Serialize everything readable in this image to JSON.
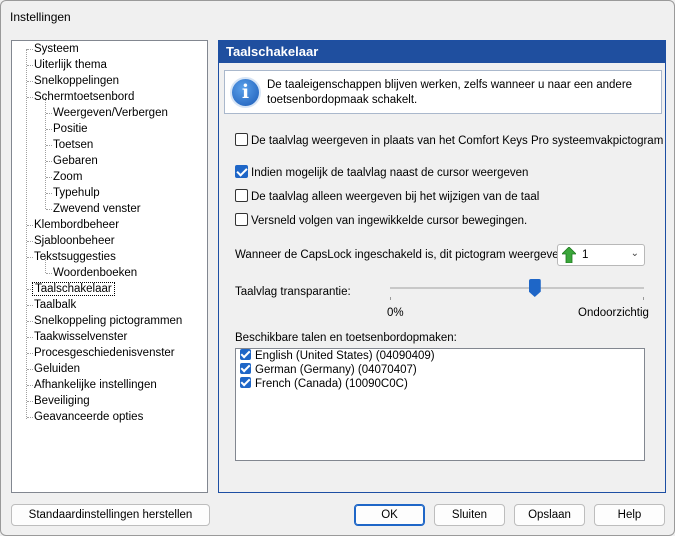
{
  "window": {
    "title": "Instellingen"
  },
  "tree": {
    "items": [
      {
        "label": "Systeem"
      },
      {
        "label": "Uiterlijk thema"
      },
      {
        "label": "Snelkoppelingen"
      },
      {
        "label": "Schermtoetsenbord"
      },
      {
        "label": "Weergeven/Verbergen"
      },
      {
        "label": "Positie"
      },
      {
        "label": "Toetsen"
      },
      {
        "label": "Gebaren"
      },
      {
        "label": "Zoom"
      },
      {
        "label": "Typehulp"
      },
      {
        "label": "Zwevend venster"
      },
      {
        "label": "Klembordbeheer"
      },
      {
        "label": "Sjabloonbeheer"
      },
      {
        "label": "Tekstsuggesties"
      },
      {
        "label": "Woordenboeken"
      },
      {
        "label": "Taalschakelaar"
      },
      {
        "label": "Taalbalk"
      },
      {
        "label": "Snelkoppeling pictogrammen"
      },
      {
        "label": "Taakwisselvenster"
      },
      {
        "label": "Procesgeschiedenisvenster"
      },
      {
        "label": "Geluiden"
      },
      {
        "label": "Afhankelijke instellingen"
      },
      {
        "label": "Beveiliging"
      },
      {
        "label": "Geavanceerde opties"
      }
    ],
    "selected": "Taalschakelaar"
  },
  "panel": {
    "title": "Taalschakelaar",
    "info_text": "De taaleigenschappen blijven werken, zelfs wanneer u naar een andere toetsenbordopmaak schakelt.",
    "options": [
      {
        "label": "De taalvlag weergeven in plaats van het Comfort Keys Pro systeemvakpictogram",
        "checked": false
      },
      {
        "label": "Indien mogelijk de taalvlag naast de cursor weergeven",
        "checked": true
      },
      {
        "label": "De taalvlag alleen weergeven bij het wijzigen van de taal",
        "checked": false
      },
      {
        "label": "Versneld volgen van ingewikkelde cursor bewegingen.",
        "checked": false
      }
    ],
    "capslock_label": "Wanneer de CapsLock ingeschakeld is, dit pictogram weergeven:",
    "capslock_value": "1",
    "transparency_label": "Taalvlag transparantie:",
    "transparency_min": "0%",
    "transparency_max": "Ondoorzichtig",
    "transparency_level": 0.57,
    "languages_label": "Beschikbare talen en toetsenbordopmaken:",
    "languages": [
      {
        "label": "English (United States) (04090409)",
        "checked": true
      },
      {
        "label": "German (Germany) (04070407)",
        "checked": true
      },
      {
        "label": "French (Canada) (10090C0C)",
        "checked": true
      }
    ]
  },
  "buttons": {
    "reset": "Standaardinstellingen herstellen",
    "ok": "OK",
    "close": "Sluiten",
    "save": "Opslaan",
    "help": "Help"
  },
  "colors": {
    "accent": "#1f4f9f",
    "check": "#1e66c7",
    "caps_arrow": "#3aa63a"
  },
  "icons": {
    "info": "info-icon",
    "capslock": "green-up-arrow-icon",
    "dropdown": "chevron-down-icon"
  }
}
